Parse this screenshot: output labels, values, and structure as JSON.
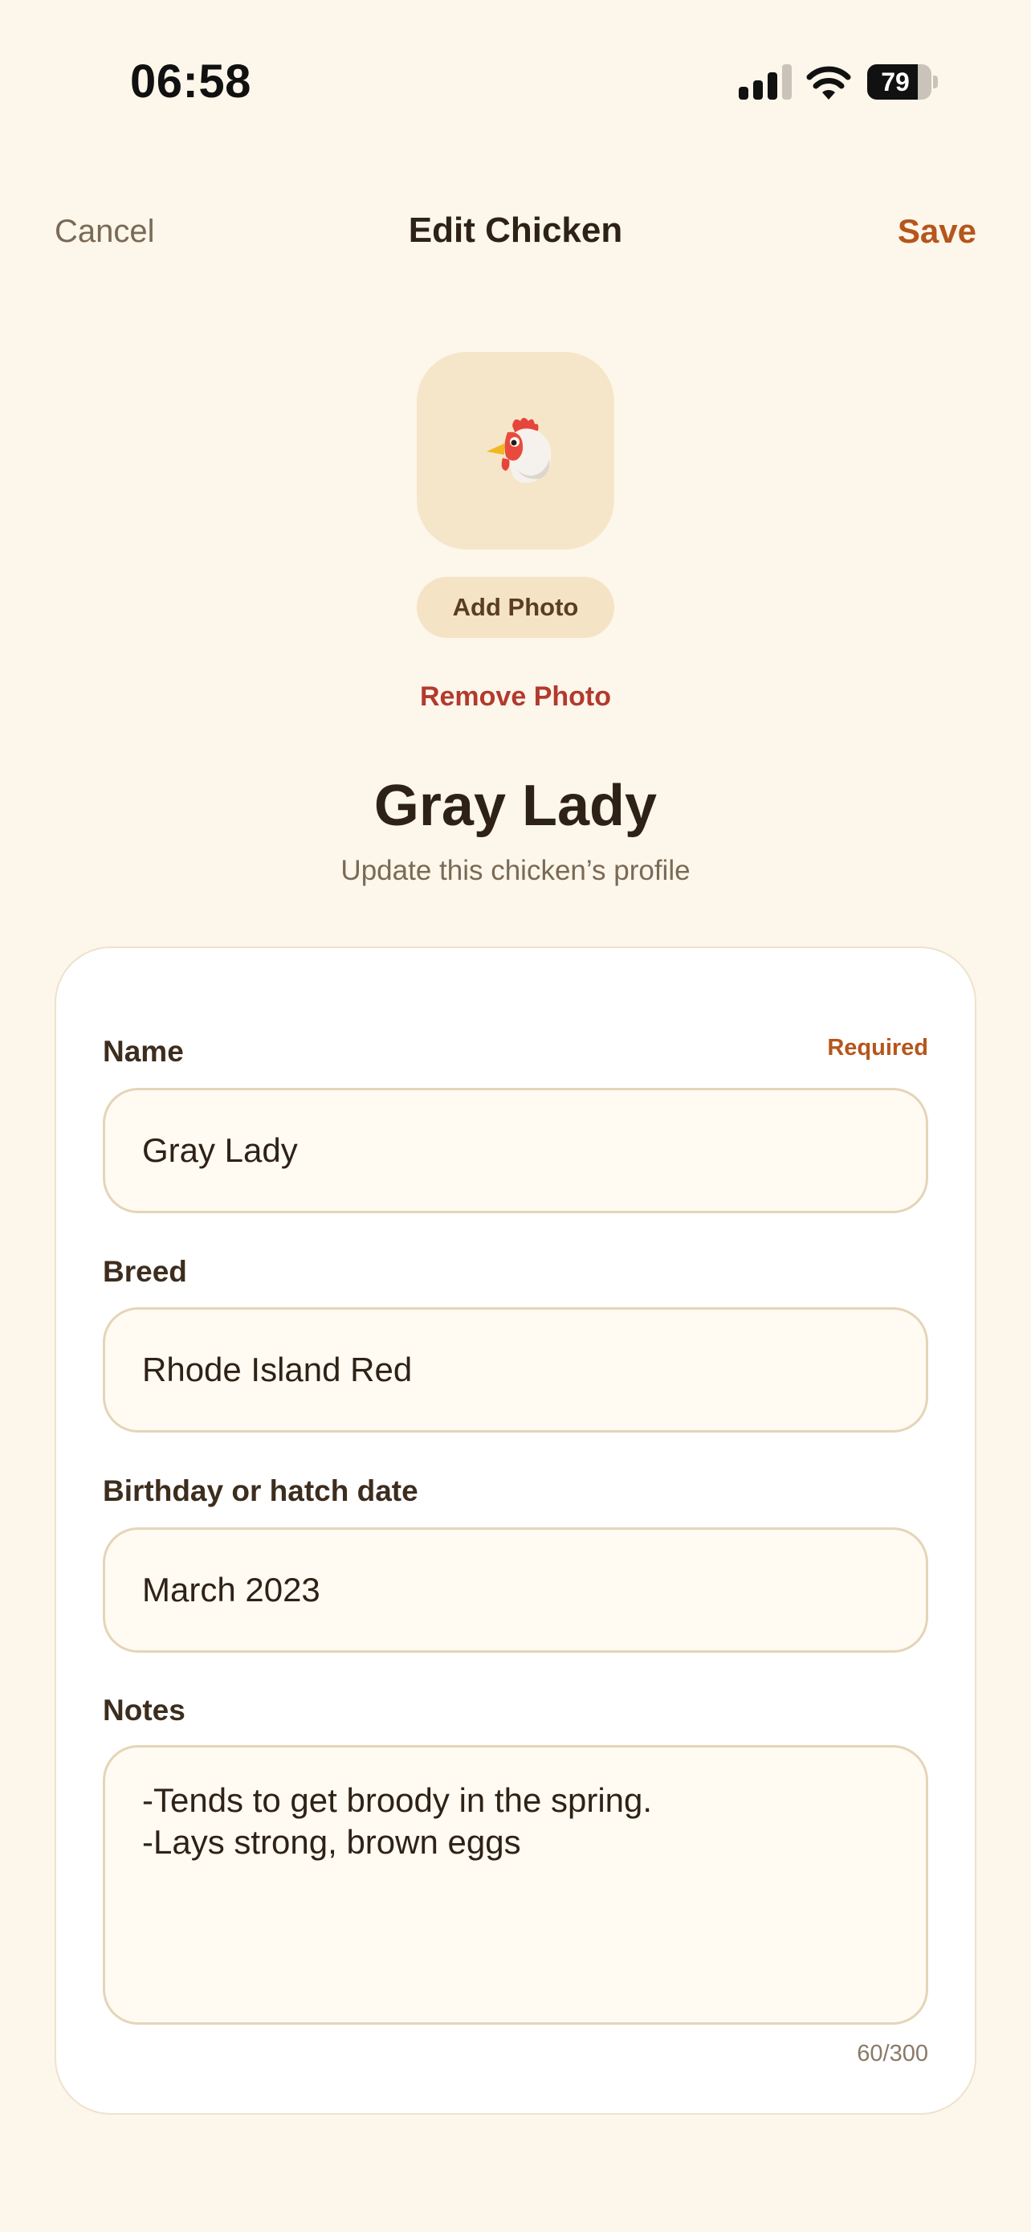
{
  "status_bar": {
    "time": "06:58",
    "battery": "79",
    "battery_level": 0.79
  },
  "nav": {
    "cancel_label": "Cancel",
    "title": "Edit Chicken",
    "save_label": "Save"
  },
  "photo": {
    "add_label": "Add Photo",
    "remove_label": "Remove Photo",
    "avatar_icon": "chicken-emoji-icon"
  },
  "header": {
    "name": "Gray Lady",
    "subtitle": "Update this chicken’s profile"
  },
  "form": {
    "name": {
      "label": "Name",
      "required_label": "Required",
      "value": "Gray Lady"
    },
    "breed": {
      "label": "Breed",
      "value": "Rhode Island Red"
    },
    "birthday": {
      "label": "Birthday or hatch date",
      "value": "March 2023"
    },
    "notes": {
      "label": "Notes",
      "value": "-Tends to get broody in the spring.\n-Lays strong, brown eggs",
      "counter": "60/300"
    }
  },
  "colors": {
    "accent": "#b5561c",
    "danger": "#b23a2e",
    "background": "#fdf6eb",
    "avatar_bg": "#f6e6c9"
  }
}
